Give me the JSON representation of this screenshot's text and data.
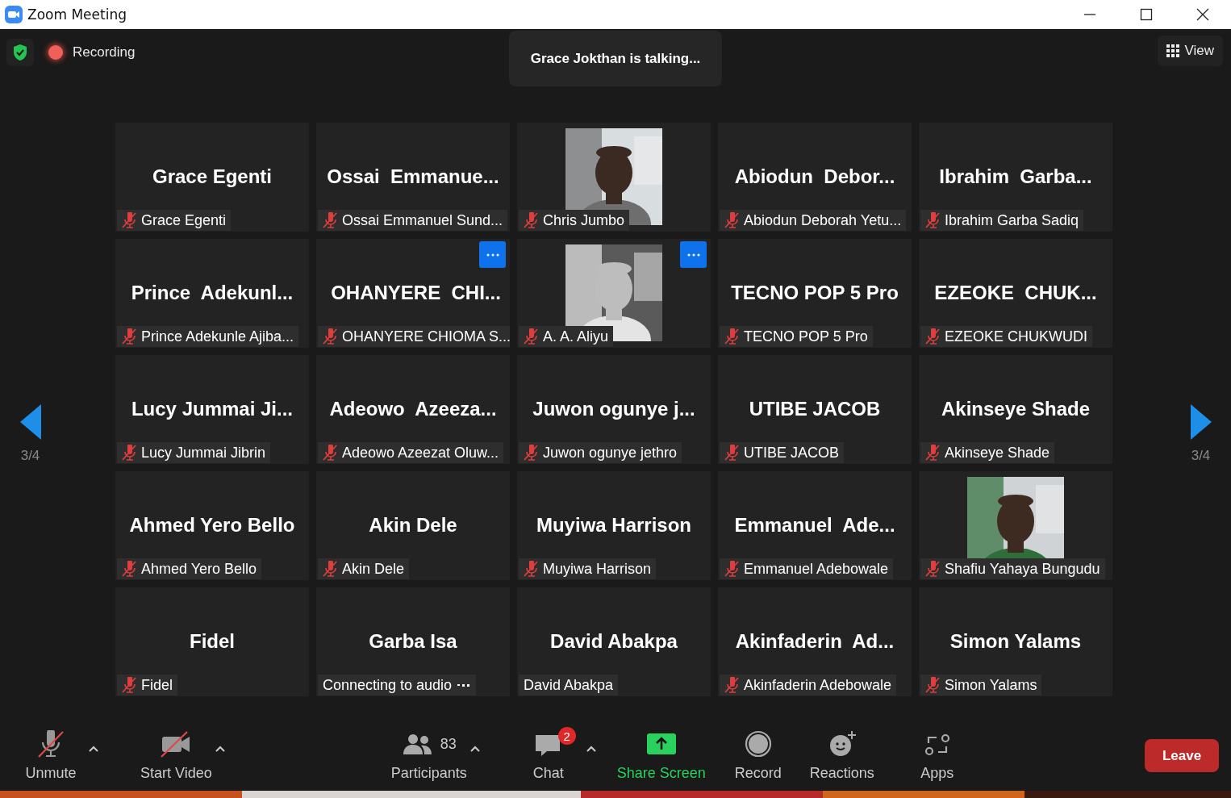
{
  "window": {
    "title": "Zoom Meeting"
  },
  "top_bar": {
    "recording_label": "Recording",
    "talking": "Grace Jokthan is talking...",
    "view_button": "View"
  },
  "pager": {
    "left": "3/4",
    "right": "3/4"
  },
  "tiles": [
    {
      "display_name": "Grace Egenti",
      "label": "Grace Egenti",
      "muted": true
    },
    {
      "display_name": "Ossai  Emmanue...",
      "label": "Ossai Emmanuel Sund...",
      "muted": true
    },
    {
      "kind": "picture",
      "label": "Chris Jumbo",
      "muted": true
    },
    {
      "display_name": "Abiodun  Debor...",
      "label": "Abiodun Deborah Yetu...",
      "muted": true
    },
    {
      "display_name": "Ibrahim  Garba...",
      "label": "Ibrahim Garba Sadiq",
      "muted": true
    },
    {
      "display_name": "Prince  Adekunl...",
      "label": "Prince Adekunle Ajiba...",
      "muted": true
    },
    {
      "display_name": "OHANYERE  CHI...",
      "label": "OHANYERE CHIOMA S...",
      "muted": true,
      "menu": true
    },
    {
      "kind": "picture",
      "label": "A. A. Aliyu",
      "muted": true,
      "menu": true
    },
    {
      "display_name": "TECNO POP 5 Pro",
      "label": "TECNO POP 5 Pro",
      "muted": true
    },
    {
      "display_name": "EZEOKE  CHUK...",
      "label": "EZEOKE CHUKWUDI",
      "muted": true
    },
    {
      "display_name": "Lucy Jummai Ji...",
      "label": "Lucy Jummai Jibrin",
      "muted": true
    },
    {
      "display_name": "Adeowo  Azeeza...",
      "label": "Adeowo Azeezat Oluw...",
      "muted": true
    },
    {
      "display_name": "Juwon ogunye j...",
      "label": "Juwon ogunye jethro",
      "muted": true
    },
    {
      "display_name": "UTIBE JACOB",
      "label": "UTIBE JACOB",
      "muted": true
    },
    {
      "display_name": "Akinseye Shade",
      "label": "Akinseye Shade",
      "muted": true
    },
    {
      "display_name": "Ahmed Yero Bello",
      "label": "Ahmed Yero Bello",
      "muted": true
    },
    {
      "display_name": "Akin Dele",
      "label": "Akin Dele",
      "muted": true
    },
    {
      "display_name": "Muyiwa Harrison",
      "label": "Muyiwa Harrison",
      "muted": true
    },
    {
      "display_name": "Emmanuel  Ade...",
      "label": "Emmanuel Adebowale",
      "muted": true
    },
    {
      "kind": "picture",
      "label": "Shafiu Yahaya Bungudu",
      "muted": true
    },
    {
      "display_name": "Fidel",
      "label": "Fidel",
      "muted": true
    },
    {
      "display_name": "Garba Isa",
      "label": "Connecting to audio",
      "muted": false,
      "connecting": true
    },
    {
      "display_name": "David Abakpa",
      "label": "David Abakpa",
      "muted": false
    },
    {
      "display_name": "Akinfaderin  Ad...",
      "label": "Akinfaderin Adebowale",
      "muted": true
    },
    {
      "display_name": "Simon Yalams",
      "label": "Simon Yalams",
      "muted": true
    }
  ],
  "toolbar": {
    "items": [
      {
        "kind": "mic",
        "label": "Unmute",
        "caret": true
      },
      {
        "kind": "video",
        "label": "Start Video",
        "caret": true
      },
      {
        "kind": "participants",
        "label": "Participants",
        "count": "83",
        "caret": true
      },
      {
        "kind": "chat",
        "label": "Chat",
        "badge": "2",
        "caret": true
      },
      {
        "kind": "share",
        "label": "Share Screen"
      },
      {
        "kind": "record",
        "label": "Record"
      },
      {
        "kind": "reactions",
        "label": "Reactions"
      },
      {
        "kind": "apps",
        "label": "Apps"
      }
    ],
    "leave_button": "Leave"
  }
}
